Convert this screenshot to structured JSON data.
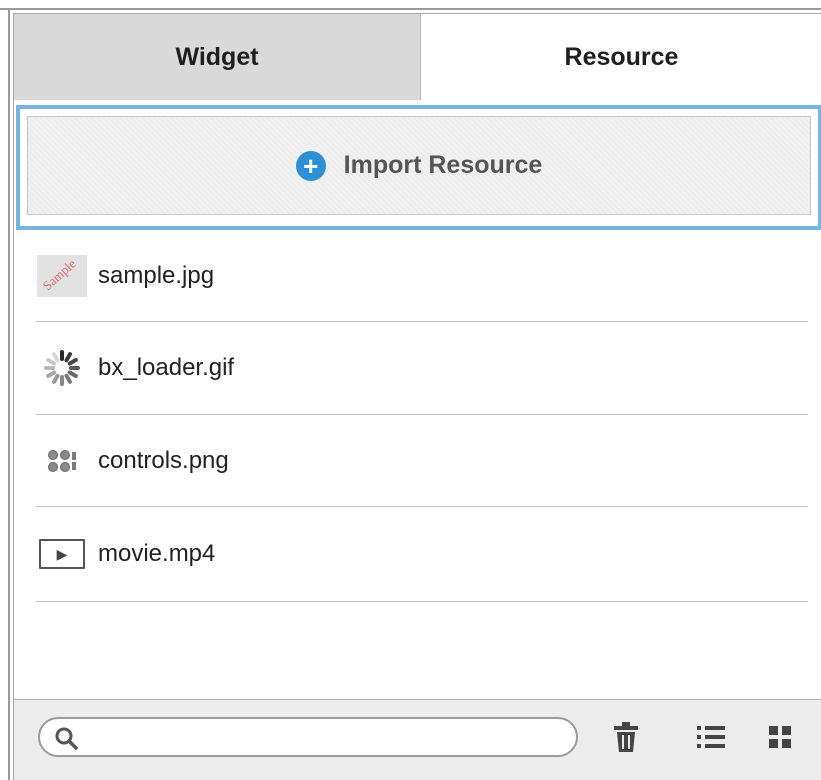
{
  "tabs": [
    {
      "label": "Widget",
      "active": true
    },
    {
      "label": "Resource",
      "active": false
    }
  ],
  "import": {
    "label": "Import Resource",
    "icon": "plus-circle-icon"
  },
  "files": [
    {
      "name": "sample.jpg",
      "icon": "image-thumbnail-icon",
      "thumb_text": "Sample"
    },
    {
      "name": "bx_loader.gif",
      "icon": "spinner-icon"
    },
    {
      "name": "controls.png",
      "icon": "controls-thumbnail-icon"
    },
    {
      "name": "movie.mp4",
      "icon": "video-play-icon"
    }
  ],
  "footer": {
    "search_placeholder": "",
    "search_value": "",
    "tools": [
      "trash-icon",
      "list-view-icon",
      "grid-view-icon"
    ]
  },
  "colors": {
    "accent": "#74b6de",
    "plus": "#2d8fd6",
    "active_tab": "#d9d9d9"
  }
}
